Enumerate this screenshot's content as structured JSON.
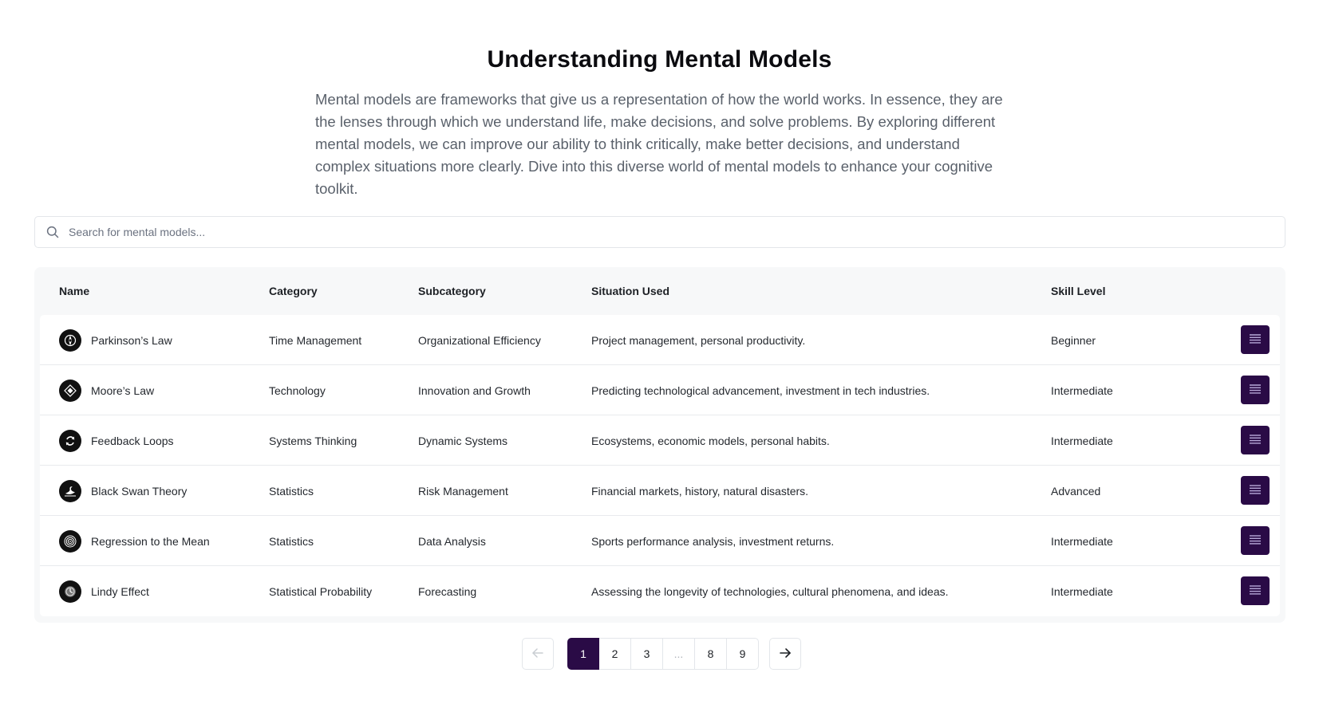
{
  "header": {
    "title": "Understanding Mental Models",
    "intro": "Mental models are frameworks that give us a representation of how the world works. In essence, they are the lenses through which we understand life, make decisions, and solve problems. By exploring different mental models, we can improve our ability to think critically, make better decisions, and understand complex situations more clearly. Dive into this diverse world of mental models to enhance your cognitive toolkit."
  },
  "search": {
    "icon": "search-icon",
    "placeholder": "Search for mental models..."
  },
  "table": {
    "columns": {
      "name": "Name",
      "category": "Category",
      "subcategory": "Subcategory",
      "situation": "Situation Used",
      "skill": "Skill Level"
    },
    "rows": [
      {
        "name": "Parkinson’s Law",
        "category": "Time Management",
        "subcategory": "Organizational Efficiency",
        "situation": "Project management, personal productivity.",
        "skill": "Beginner",
        "icon": "compass-icon"
      },
      {
        "name": "Moore’s Law",
        "category": "Technology",
        "subcategory": "Innovation and Growth",
        "situation": "Predicting technological advancement, investment in tech industries.",
        "skill": "Intermediate",
        "icon": "chip-icon"
      },
      {
        "name": "Feedback Loops",
        "category": "Systems Thinking",
        "subcategory": "Dynamic Systems",
        "situation": "Ecosystems, economic models, personal habits.",
        "skill": "Intermediate",
        "icon": "loop-icon"
      },
      {
        "name": "Black Swan Theory",
        "category": "Statistics",
        "subcategory": "Risk Management",
        "situation": "Financial markets, history, natural disasters.",
        "skill": "Advanced",
        "icon": "swan-icon"
      },
      {
        "name": "Regression to the Mean",
        "category": "Statistics",
        "subcategory": "Data Analysis",
        "situation": "Sports performance analysis, investment returns.",
        "skill": "Intermediate",
        "icon": "target-icon"
      },
      {
        "name": "Lindy Effect",
        "category": "Statistical Probability",
        "subcategory": "Forecasting",
        "situation": "Assessing the longevity of technologies, cultural phenomena, and ideas.",
        "skill": "Intermediate",
        "icon": "clock-icon"
      }
    ],
    "row_action_icon": "list-icon"
  },
  "pagination": {
    "prev_icon": "arrow-left-icon",
    "next_icon": "arrow-right-icon",
    "pages": [
      "1",
      "2",
      "3",
      "...",
      "8",
      "9"
    ],
    "current": "1"
  },
  "colors": {
    "accent": "#2a0b46",
    "muted_text": "#5a616b",
    "row_border": "#e8eaed"
  }
}
